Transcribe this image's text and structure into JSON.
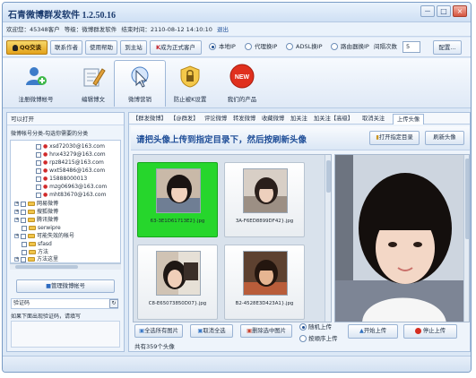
{
  "window": {
    "title": "石青微博群发软件 1.2.50.16",
    "controls": [
      "－",
      "□",
      "×"
    ]
  },
  "info": {
    "welcome": "欢迎您：45348客户",
    "level_label": "等级：微博群发软件",
    "expire_label": "结束时间：2110-08-12 14:10:10",
    "logout": "退出"
  },
  "toolbar": {
    "qq_button": "QQ交谈",
    "contact_author": "联系作者",
    "help": "使用帮助",
    "forum": "到主站",
    "upgrade": "成为正式客户",
    "ip_modes": [
      {
        "label": "本地IP",
        "selected": true
      },
      {
        "label": "代理换IP",
        "selected": false
      },
      {
        "label": "ADSL换IP",
        "selected": false
      },
      {
        "label": "路由器换IP",
        "selected": false
      }
    ],
    "interval_label": "间隔次数",
    "interval_value": "5",
    "config_button": "配置..."
  },
  "nav": {
    "items": [
      {
        "label": "注册微博帐号",
        "icon": "user-register-icon"
      },
      {
        "label": "编辑博文",
        "icon": "edit-pen-icon"
      },
      {
        "label": "微博营销",
        "icon": "marketing-cursor-icon",
        "active": true
      },
      {
        "label": "防止被K设置",
        "icon": "lock-shield-icon"
      },
      {
        "label": "我们的产品",
        "icon": "new-badge-icon",
        "badge": "NEW"
      }
    ]
  },
  "left": {
    "open_label": "可以打开",
    "group_hint": "微博帐号分类-勾选你需要的分类",
    "accounts": [
      "xsd72030@163.com",
      "hnx43279@163.com",
      "rpz84215@163.com",
      "wxt58486@163.com",
      "15888000013",
      "mzg06963@163.com",
      "mht83670@163.com"
    ],
    "groups": [
      "网易微博",
      "搜狐微博",
      "腾讯微博",
      "serwipre",
      "可能失效的帐号",
      "sfasd",
      "方法",
      "方法这里"
    ],
    "manage_button": "管理微博帐号",
    "captcha_label": "验证码",
    "captcha_hint": "如果下面出现验证码，请填写"
  },
  "tabs": [
    "【群发微博】",
    "【@群发】",
    "评论微博",
    "转发微博",
    "收藏微博",
    "加关注",
    "加关注【高级】",
    "取消关注",
    "上传头像"
  ],
  "active_tab": "上传头像",
  "upload": {
    "instruction": "请把头像上传到指定目录下，然后按刷新头像",
    "open_folder_button": "打开指定目录",
    "refresh_button": "刷新头像",
    "images": [
      {
        "file": "63-3E1D61713E2}.jpg",
        "selected": true
      },
      {
        "file": "3A-F6ED8899DF42}.jpg",
        "selected": false
      },
      {
        "file": "C8-E65073850D07}.jpg",
        "selected": false
      },
      {
        "file": "B2-4528E3D423A1}.jpg",
        "selected": false
      }
    ],
    "select_all_button": "全选所有图片",
    "deselect_button": "取消全选",
    "delete_button": "删除选中图片",
    "count_text": "共有359个头像",
    "order_options": [
      {
        "label": "随机上传",
        "selected": true
      },
      {
        "label": "按顺序上传",
        "selected": false
      }
    ],
    "upload_button": "开始上传",
    "stop_button": "停止上传"
  },
  "colors": {
    "title_text": "#1b3b6e",
    "instruction_text": "#1f4e98",
    "selected_thumb": "#26d62c",
    "new_badge": "#e0301e"
  }
}
